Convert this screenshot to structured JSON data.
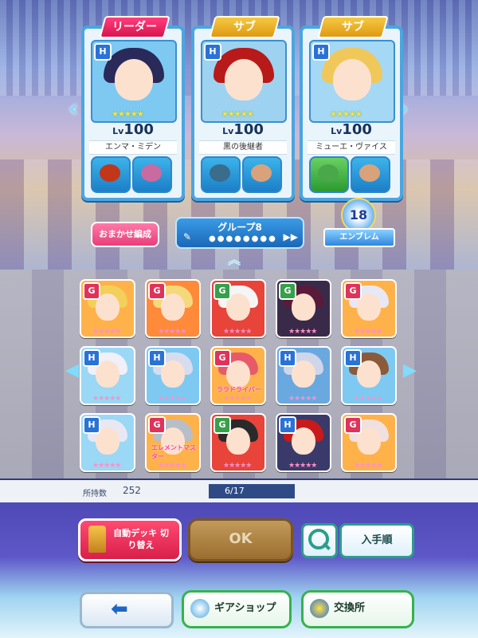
{
  "team": {
    "leader_tag": "リーダー",
    "sub_tag": "サブ",
    "characters": [
      {
        "name": "エンマ・ミデン",
        "level_prefix": "Lv",
        "level": "100",
        "badge": "H",
        "stars": "★★★★★",
        "hair": "#2a2a5a",
        "bg": "#7ec9f2"
      },
      {
        "name": "黒の後継者",
        "level_prefix": "Lv",
        "level": "100",
        "badge": "H",
        "stars": "★★★★★",
        "hair": "#b81a1a",
        "bg": "#9dd3f0"
      },
      {
        "name": "ミューエ・ヴァイス",
        "level_prefix": "Lv",
        "level": "100",
        "badge": "H",
        "stars": "★★★★★",
        "hair": "#f0c85a",
        "bg": "#a4d8f5"
      }
    ],
    "gear_colors": [
      [
        "#c2361a",
        "#c96aa0"
      ],
      [
        "#3a6c8c",
        "#d9a27a"
      ],
      [
        "#4ba84a",
        "#d9a27a"
      ]
    ]
  },
  "controls": {
    "omakase_label": "おまかせ編成",
    "group_label": "グループ8",
    "group_dots": "●●●●●●●●",
    "emblem_number": "18",
    "emblem_label": "エンブレム"
  },
  "roster": [
    {
      "badge": "G",
      "badge_color": "#e0325a",
      "bg": "#ffb24a",
      "hair": "#f2d05a",
      "stars": "★★★★★",
      "label": ""
    },
    {
      "badge": "G",
      "badge_color": "#e0325a",
      "bg": "#ff8a3a",
      "hair": "#f5d87a",
      "stars": "★★★★★",
      "label": ""
    },
    {
      "badge": "G",
      "badge_color": "#36a04a",
      "bg": "#e8443a",
      "hair": "#f5f5f5",
      "stars": "★★★★★",
      "label": ""
    },
    {
      "badge": "G",
      "badge_color": "#36a04a",
      "bg": "#3a2a4a",
      "hair": "#5a1a3a",
      "stars": "★★★★★",
      "label": ""
    },
    {
      "badge": "G",
      "badge_color": "#e0325a",
      "bg": "#ffb24a",
      "hair": "#e8e8f5",
      "stars": "★★★★★",
      "label": ""
    },
    {
      "badge": "H",
      "badge_color": "#2a72d6",
      "bg": "#9ad8f5",
      "hair": "#f0f0f8",
      "stars": "★★★★★",
      "label": ""
    },
    {
      "badge": "H",
      "badge_color": "#2a72d6",
      "bg": "#7ec9f2",
      "hair": "#d8dcef",
      "stars": "★★★★★",
      "label": ""
    },
    {
      "badge": "G",
      "badge_color": "#e0325a",
      "bg": "#ffb24a",
      "hair": "#e85a6a",
      "stars": "★★★★★",
      "label": "ララドライバー"
    },
    {
      "badge": "H",
      "badge_color": "#2a72d6",
      "bg": "#6aa8e0",
      "hair": "#cfd6ea",
      "stars": "★★★★★",
      "label": ""
    },
    {
      "badge": "H",
      "badge_color": "#2a72d6",
      "bg": "#7ec9f2",
      "hair": "#8a5a3a",
      "stars": "★★★★★",
      "label": ""
    },
    {
      "badge": "H",
      "badge_color": "#2a72d6",
      "bg": "#9ad8f5",
      "hair": "#e8e8f5",
      "stars": "★★★★★",
      "label": ""
    },
    {
      "badge": "G",
      "badge_color": "#e0325a",
      "bg": "#ffb24a",
      "hair": "#b8bec8",
      "stars": "★★★★★",
      "label": "エレメントマスター"
    },
    {
      "badge": "G",
      "badge_color": "#36a04a",
      "bg": "#e8443a",
      "hair": "#2a2a2a",
      "stars": "★★★★★",
      "label": ""
    },
    {
      "badge": "H",
      "badge_color": "#2a72d6",
      "bg": "#3a3a6a",
      "hair": "#c81a1a",
      "stars": "★★★★★",
      "label": ""
    },
    {
      "badge": "G",
      "badge_color": "#e0325a",
      "bg": "#ffb24a",
      "hair": "#f0e0e0",
      "stars": "★★★★★",
      "label": ""
    }
  ],
  "status": {
    "owned_label": "所持数",
    "owned_count": "252",
    "page": "6/17"
  },
  "actions": {
    "auto_deck_label": "自動デッキ 切り替え",
    "ok_label": "OK",
    "sort_label": "入手順",
    "gear_shop_label": "ギアショップ",
    "exchange_label": "交換所"
  }
}
